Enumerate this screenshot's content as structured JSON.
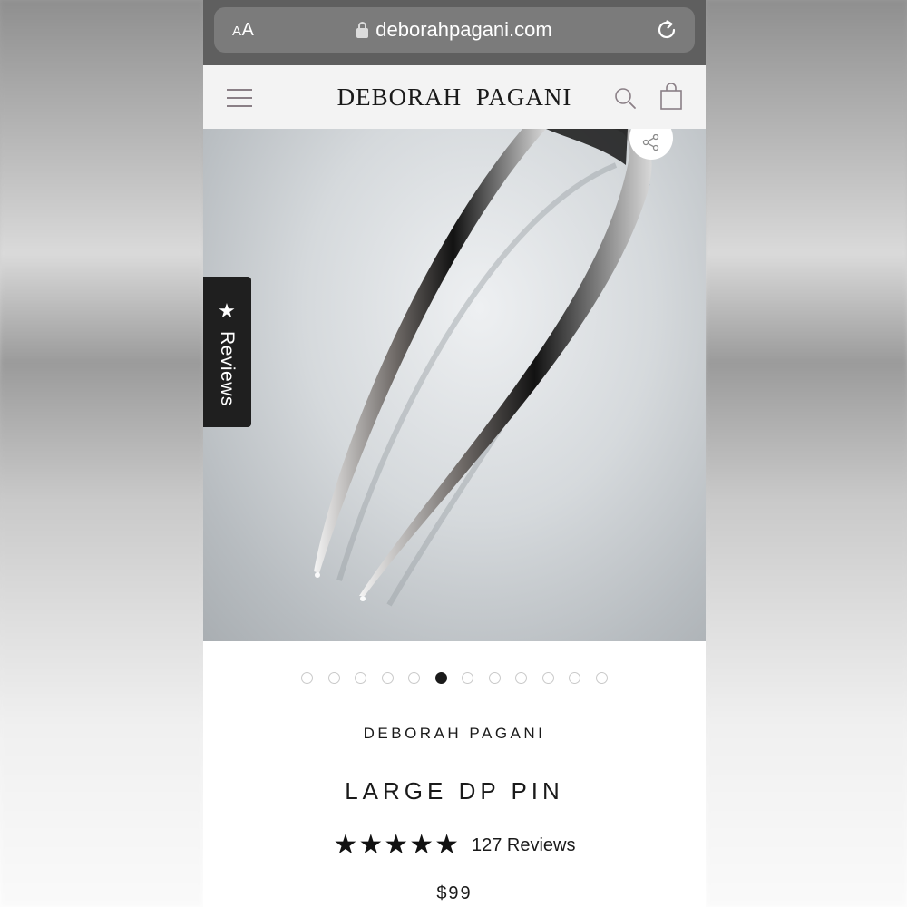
{
  "browser": {
    "text_size_label_small": "A",
    "text_size_label_large": "A",
    "url": "deborahpagani.com",
    "icons": [
      "lock-icon",
      "reload-icon"
    ]
  },
  "header": {
    "logo": "DEBORAH PAGANI",
    "icons": [
      "menu-icon",
      "search-icon",
      "bag-icon"
    ]
  },
  "gallery": {
    "total_images": 12,
    "active_index": 5,
    "share_icon": "share-icon",
    "reviews_tab": {
      "icon": "star-icon",
      "icon_glyph": "★",
      "label": "Reviews"
    }
  },
  "product": {
    "brand": "DEBORAH PAGANI",
    "title": "LARGE DP PIN",
    "rating_stars": 5,
    "star_glyph": "★",
    "reviews_label": "127 Reviews",
    "price": "$99"
  },
  "colors": {
    "browser_bar": "#5f5f5f",
    "header_bg": "#f3f3f3",
    "text": "#1a1a1a",
    "reviews_tab": "#1f1f1f"
  }
}
